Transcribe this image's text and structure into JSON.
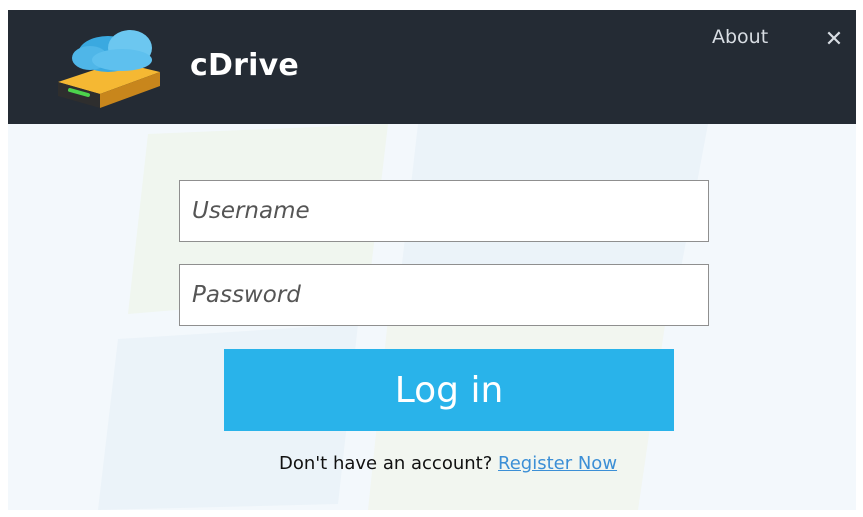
{
  "header": {
    "app_title": "cDrive",
    "about_label": "About",
    "close_glyph": "✕",
    "logo_icon": "cloud-drive-icon"
  },
  "login_form": {
    "username_placeholder": "Username",
    "password_placeholder": "Password",
    "login_label": "Log in",
    "register_prompt": "Don't have an account?",
    "register_link": "Register Now"
  },
  "colors": {
    "header_bg": "#242b34",
    "login_button": "#29b3ea",
    "link": "#3c8fd6",
    "body_bg": "#f3f8fc"
  }
}
